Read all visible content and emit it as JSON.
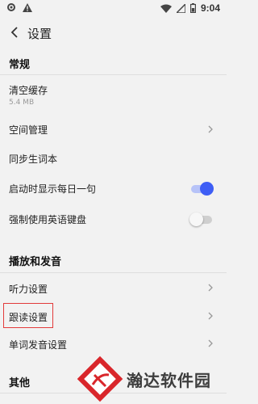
{
  "status_bar": {
    "time": "9:04",
    "left_icons": [
      "gear-icon",
      "warning-icon"
    ],
    "right_icons": [
      "wifi-icon",
      "sim-icon",
      "battery-icon"
    ]
  },
  "header": {
    "title": "设置",
    "back_icon": "chevron-left-icon"
  },
  "sections": [
    {
      "title": "常规",
      "items": [
        {
          "label": "清空缓存",
          "sub": "5.4 MB",
          "control": "none"
        },
        {
          "label": "空间管理",
          "control": "chevron"
        },
        {
          "label": "同步生词本",
          "control": "none"
        },
        {
          "label": "启动时显示每日一句",
          "control": "toggle",
          "value": true
        },
        {
          "label": "强制使用英语键盘",
          "control": "toggle",
          "value": false
        }
      ]
    },
    {
      "title": "播放和发音",
      "items": [
        {
          "label": "听力设置",
          "control": "chevron"
        },
        {
          "label": "跟读设置",
          "control": "chevron",
          "highlighted": true
        },
        {
          "label": "单词发音设置",
          "control": "chevron"
        }
      ]
    },
    {
      "title": "其他",
      "items": []
    }
  ],
  "colors": {
    "toggle_on_track": "#b7c3f8",
    "toggle_on_knob": "#3e5ef5",
    "toggle_off_track": "#cfcfcf",
    "toggle_off_knob": "#f7f7f7",
    "highlight_border": "#e23b3b",
    "watermark_red": "#d9262b"
  },
  "watermark": {
    "text": "瀚达软件园"
  }
}
